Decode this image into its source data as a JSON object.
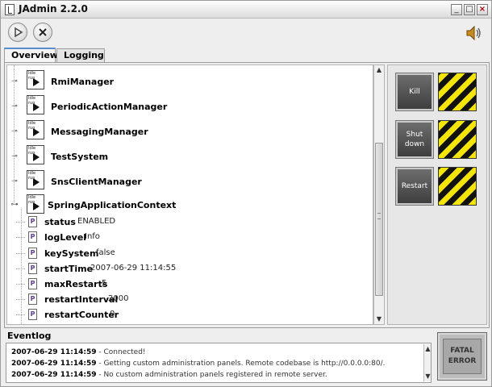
{
  "window": {
    "title": "JAdmin 2.2.0",
    "buttons": {
      "minimize": "_",
      "maximize": "□",
      "close": "×"
    }
  },
  "toolbar": {
    "play_icon": "play-icon",
    "stop_icon": "stop-icon",
    "speaker_icon": "speaker-icon"
  },
  "tabs": [
    {
      "label": "Overview",
      "active": true
    },
    {
      "label": "Logging",
      "active": false
    }
  ],
  "tree": {
    "nodes": [
      {
        "label": "RmiManager"
      },
      {
        "label": "PeriodicActionManager"
      },
      {
        "label": "MessagingManager"
      },
      {
        "label": "TestSystem"
      },
      {
        "label": "SnsClientManager"
      },
      {
        "label": "SpringApplicationContext"
      }
    ],
    "icon_caption": "Idle run",
    "properties": [
      {
        "name": "status",
        "value": "ENABLED"
      },
      {
        "name": "logLevel",
        "value": "Info"
      },
      {
        "name": "keySystem",
        "value": "false"
      },
      {
        "name": "startTime",
        "value": "2007-06-29 11:14:55"
      },
      {
        "name": "maxRestarts",
        "value": "5"
      },
      {
        "name": "restartInterval",
        "value": "2000"
      },
      {
        "name": "restartCounter",
        "value": "0"
      }
    ],
    "prop_icon_letter": "P"
  },
  "controls": {
    "kill_label": "Kill",
    "shutdown_label": "Shut down",
    "restart_label": "Restart",
    "hazard_colors": [
      "#f4e600",
      "#111111"
    ]
  },
  "eventlog": {
    "title": "Eventlog",
    "lines": [
      {
        "time": "2007-06-29 11:14:59",
        "text": " - Connected!"
      },
      {
        "time": "2007-06-29 11:14:59",
        "text": " - Getting custom administration panels. Remote codebase is http://0.0.0.0:80/."
      },
      {
        "time": "2007-06-29 11:14:59",
        "text": " - No custom administration panels registered in remote server."
      }
    ]
  },
  "fatal_button": {
    "label": "FATAL ERROR"
  }
}
